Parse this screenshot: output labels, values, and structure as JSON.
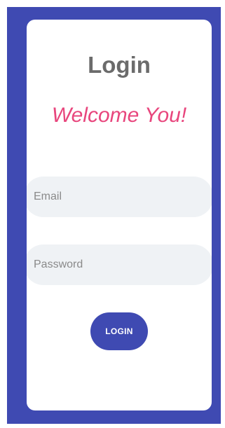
{
  "login": {
    "title": "Login",
    "welcome": "Welcome You!",
    "email_placeholder": "Email",
    "email_value": "",
    "password_placeholder": "Password",
    "password_value": "",
    "button_label": "LOGIN"
  },
  "colors": {
    "background": "#3f4ab2",
    "card": "#ffffff",
    "title": "#6b6b6b",
    "welcome": "#e8467d",
    "field": "#eff2f5",
    "button": "#3f4ab2",
    "button_text": "#ffffff"
  }
}
